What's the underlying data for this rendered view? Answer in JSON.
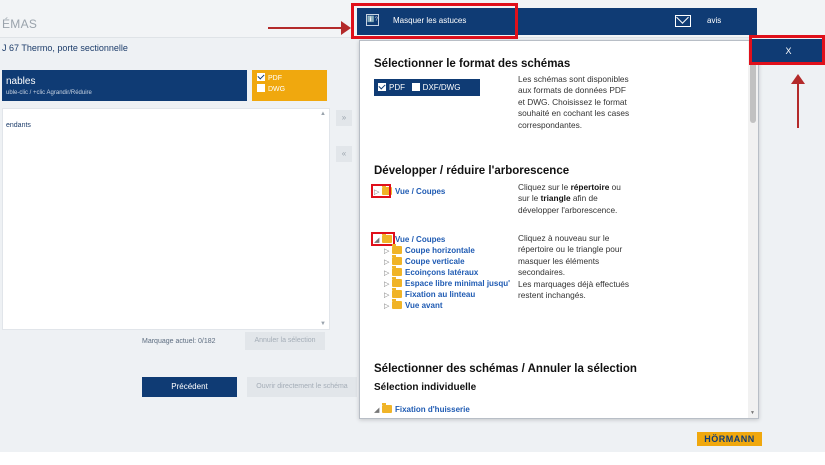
{
  "background": {
    "title": "ÉMAS",
    "subtitle": "J 67 Thermo, porte sectionnelle",
    "panel_title": "nables",
    "panel_hint": "uble-clic / +clic Agrandir/Réduire",
    "format_options": [
      "PDF",
      "DWG"
    ],
    "tree_label": "endants",
    "arrow_right": "»",
    "arrow_left": "«",
    "scroll_up": "▲",
    "scroll_down": "▼",
    "marquage": "Marquage actuel: 0/182",
    "annuler_button": "Annuler la sélection",
    "prev_button": "Précédent",
    "open_button": "Ouvrir directement le schéma",
    "brand": "HÖRMANN"
  },
  "header": {
    "tips_icon": "ℹ️?",
    "tips_button": "Masquer les astuces",
    "avis_label": "avis"
  },
  "close_button": "X",
  "popup": {
    "scroll_up": "▲",
    "scroll_down": "▼",
    "section1_title": "Sélectionner le format des schémas",
    "format_pdf": "PDF",
    "format_dxf": "DXF/DWG",
    "section1_desc": "Les schémas sont disponibles aux formats de données PDF et DWG. Choisissez le format souhaité en cochant les cases correspondantes.",
    "section2_title": "Développer / réduire l'arborescence",
    "tree_collapsed": "Vue / Coupes",
    "section2_desc1_a": "Cliquez sur le ",
    "section2_desc1_b": "répertoire",
    "section2_desc1_c": " ou sur le ",
    "section2_desc1_d": "triangle",
    "section2_desc1_e": " afin de développer l'arborescence.",
    "tree_expanded": "Vue / Coupes",
    "tree_children": [
      "Coupe horizontale",
      "Coupe verticale",
      "Ecoinçons latéraux",
      "Espace libre minimal jusqu'",
      "Fixation au linteau",
      "Vue avant"
    ],
    "section2_desc2": "Cliquez à nouveau sur le répertoire ou le triangle pour masquer les éléments secondaires.",
    "section2_desc3": "Les marquages déjà effectués restent inchangés.",
    "section3_title": "Sélectionner des schémas / Annuler la sélection",
    "section3_sub": "Sélection individuelle",
    "tree_item": "Fixation d'huisserie"
  }
}
